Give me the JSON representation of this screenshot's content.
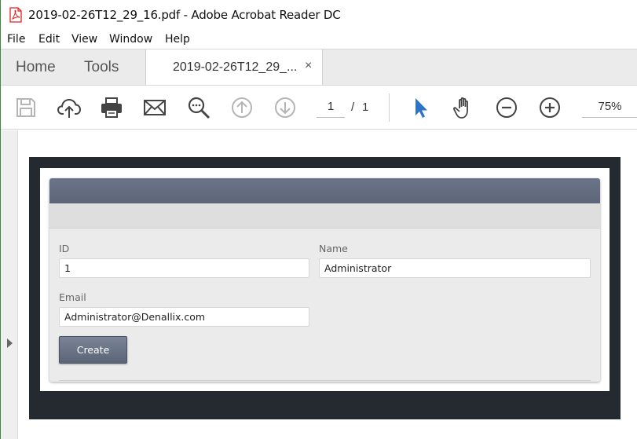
{
  "window": {
    "title": "2019-02-26T12_29_16.pdf - Adobe Acrobat Reader DC"
  },
  "menu": {
    "items": [
      "File",
      "Edit",
      "View",
      "Window",
      "Help"
    ]
  },
  "tabs": {
    "home": "Home",
    "tools": "Tools",
    "document": "2019-02-26T12_29_...",
    "close_glyph": "×"
  },
  "toolbar": {
    "icons": [
      "save-icon",
      "upload-cloud-icon",
      "print-icon",
      "email-icon",
      "search-icon",
      "page-up-icon",
      "page-down-icon",
      "select-cursor-icon",
      "hand-tool-icon",
      "zoom-out-icon",
      "zoom-in-icon"
    ],
    "page_current": "1",
    "page_separator": "/",
    "page_total": "1",
    "zoom": "75%",
    "accent_color": "#2b74c7"
  },
  "form": {
    "header_color": "#646d80",
    "id_label": "ID",
    "id_value": "1",
    "name_label": "Name",
    "name_value": "Administrator",
    "email_label": "Email",
    "email_value": "Administrator@Denallix.com",
    "create_label": "Create"
  }
}
